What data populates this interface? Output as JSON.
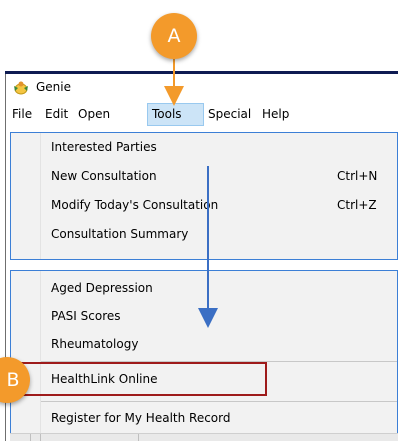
{
  "app": {
    "title": "Genie",
    "icon": "genie-app-icon"
  },
  "menubar": {
    "items": [
      {
        "label": "File"
      },
      {
        "label": "Edit"
      },
      {
        "label": "Open"
      },
      {
        "label": "Tools",
        "active": true
      },
      {
        "label": "Special"
      },
      {
        "label": "Help"
      }
    ]
  },
  "dropdown_top": {
    "items": [
      {
        "label": "Interested Parties",
        "shortcut": ""
      },
      {
        "label": "New Consultation",
        "shortcut": "Ctrl+N"
      },
      {
        "label": "Modify Today's Consultation",
        "shortcut": "Ctrl+Z"
      },
      {
        "label": "Consultation Summary",
        "shortcut": ""
      }
    ]
  },
  "dropdown_bottom": {
    "items": [
      {
        "label": "Aged Depression"
      },
      {
        "label": "PASI Scores"
      },
      {
        "label": "Rheumatology"
      },
      {
        "label": "HealthLink Online",
        "highlighted": true
      },
      {
        "label": "Register for My Health Record"
      }
    ]
  },
  "callouts": {
    "a": "A",
    "b": "B"
  },
  "colors": {
    "callout": "#f39a2b",
    "arrow_orange": "#f39a2b",
    "arrow_blue": "#3b6fc4",
    "highlight_border": "#9e1b1b",
    "menu_active": "#cce4f7",
    "dropdown_border": "#3c7fd6"
  }
}
